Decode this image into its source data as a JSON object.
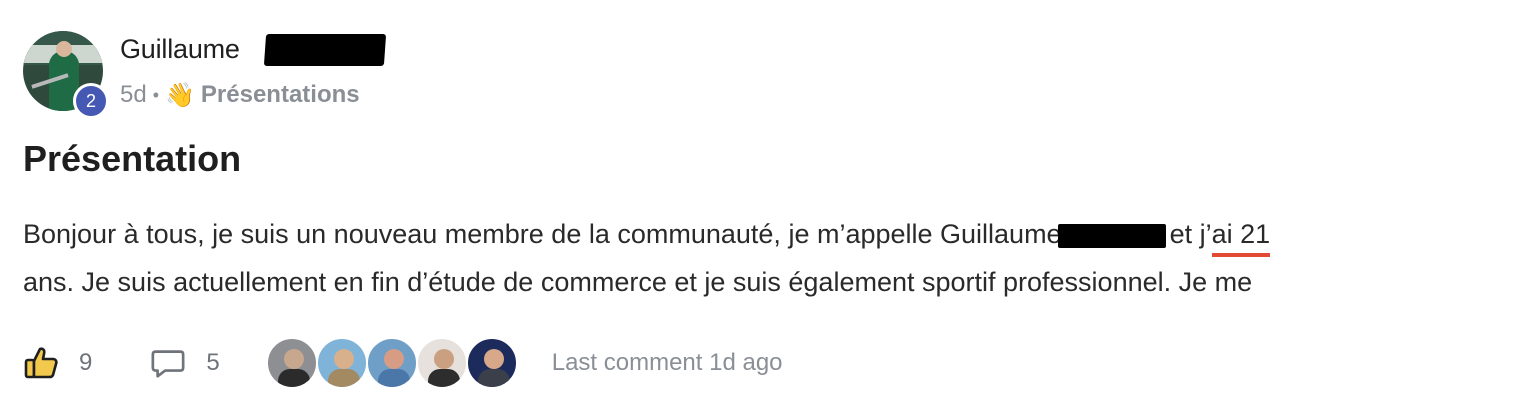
{
  "post": {
    "author_name": "Guillaume",
    "level": "2",
    "time_ago": "5d",
    "separator": "•",
    "category_emoji": "👋",
    "category": "Présentations",
    "title": "Présentation",
    "body_line1_a": "Bonjour à tous, je suis un nouveau membre de la communauté, je m’appelle Guillaume",
    "body_line1_b": "et j’",
    "body_line1_c": "ai 21",
    "body_line2": "ans. Je suis actuellement en fin d’étude de commerce et je suis également sportif professionnel. Je me"
  },
  "footer": {
    "like_icon": "thumbs-up-icon",
    "like_count": "9",
    "comment_icon": "comment-bubble-icon",
    "comment_count": "5",
    "last_comment": "Last comment 1d ago"
  },
  "colors": {
    "level_badge": "#4458b4",
    "underline": "#e34a33",
    "meta_text": "#8a8f96"
  }
}
